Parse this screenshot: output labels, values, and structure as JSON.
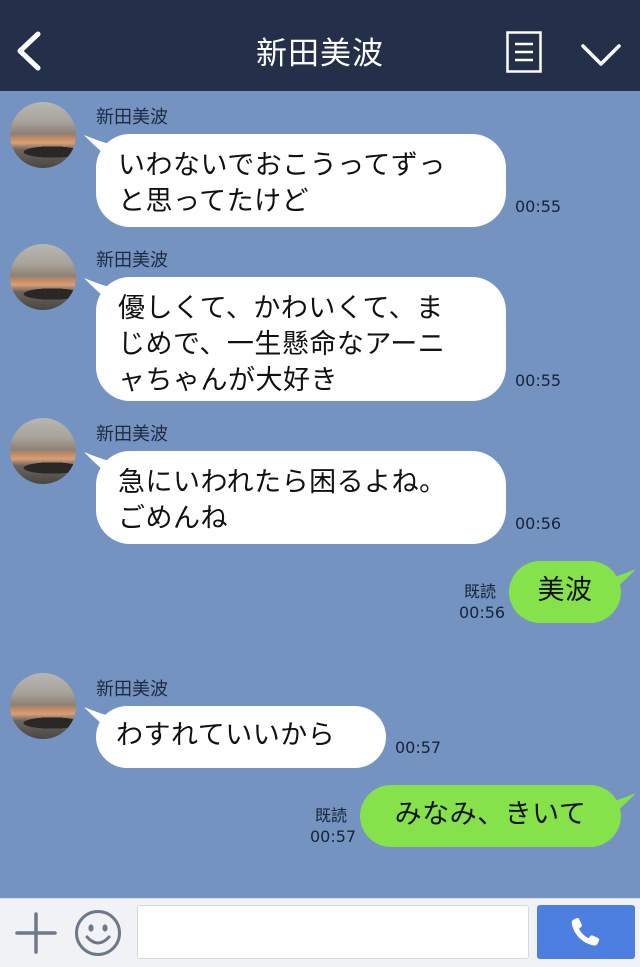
{
  "header": {
    "title": "新田美波",
    "icons": [
      "back-icon",
      "menu-icon",
      "chevron-down-icon"
    ]
  },
  "messages": [
    {
      "direction": "in",
      "sender": "新田美波",
      "lines": [
        "いわないでおこうってずっ",
        "と思ってたけど"
      ],
      "time": "00:55"
    },
    {
      "direction": "in",
      "sender": "新田美波",
      "lines": [
        "優しくて、かわいくて、ま",
        "じめで、一生懸命なアーニ",
        "ャちゃんが大好き"
      ],
      "time": "00:55"
    },
    {
      "direction": "in",
      "sender": "新田美波",
      "lines": [
        "急にいわれたら困るよね。",
        "ごめんね"
      ],
      "time": "00:56"
    },
    {
      "direction": "out",
      "read": "既読",
      "text": "美波",
      "time": "00:56"
    },
    {
      "direction": "in",
      "sender": "新田美波",
      "lines": [
        "わすれていいから"
      ],
      "time": "00:57"
    },
    {
      "direction": "out",
      "read": "既読",
      "text": "みなみ、きいて",
      "time": "00:57"
    }
  ],
  "input": {
    "value": "",
    "icons": [
      "plus-icon",
      "smile-icon",
      "phone-icon"
    ]
  },
  "colors": {
    "header_bg": "#243049",
    "chat_bg": "#7493c1",
    "incoming_bubble": "#ffffff",
    "outgoing_bubble": "#85e24a",
    "call_button": "#4d7fe0"
  }
}
